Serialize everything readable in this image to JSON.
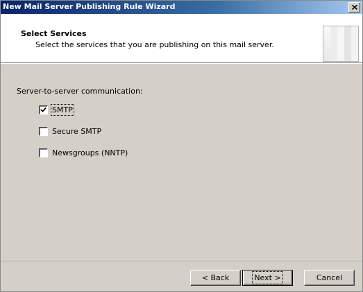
{
  "window": {
    "title": "New Mail Server Publishing Rule Wizard",
    "close_glyph": "×"
  },
  "header": {
    "title": "Select Services",
    "subtitle": "Select the services that you are publishing on this mail server."
  },
  "main": {
    "section_label": "Server-to-server communication:",
    "options": [
      {
        "label": "SMTP",
        "checked": true
      },
      {
        "label": "Secure SMTP",
        "checked": false
      },
      {
        "label": "Newsgroups (NNTP)",
        "checked": false
      }
    ]
  },
  "buttons": {
    "back": "< Back",
    "next": "Next >",
    "cancel": "Cancel"
  }
}
